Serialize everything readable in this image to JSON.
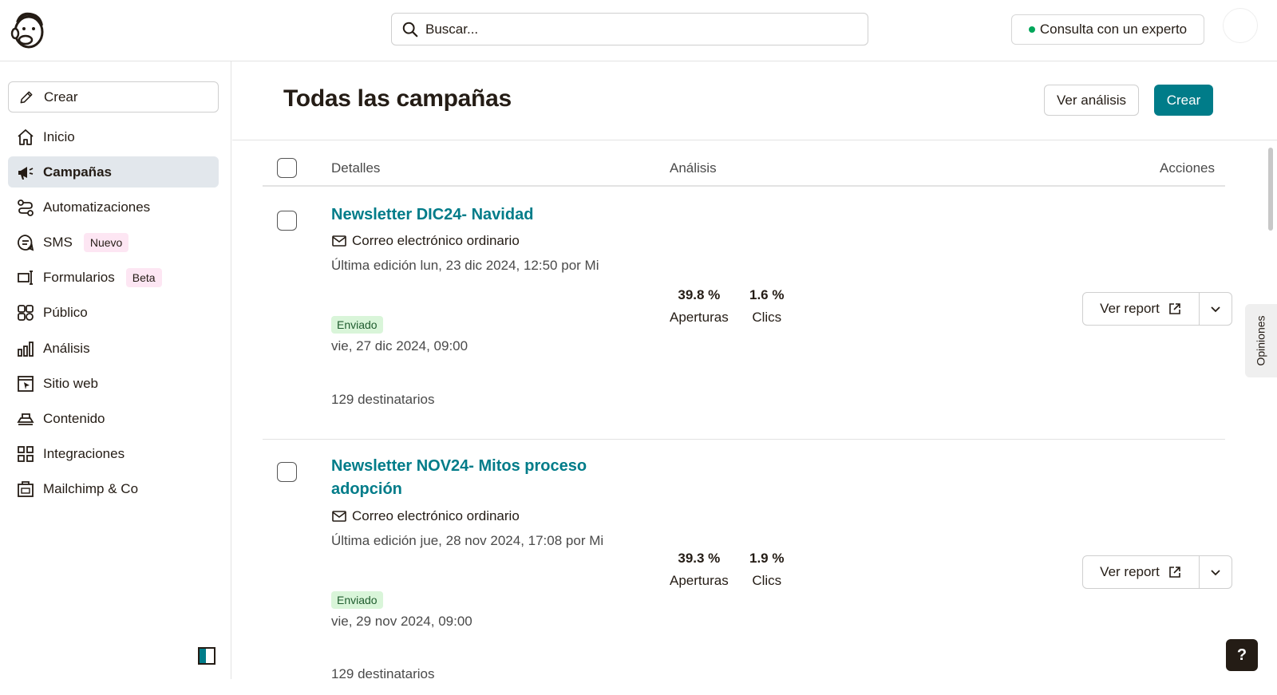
{
  "search": {
    "placeholder": "Buscar..."
  },
  "header": {
    "expert_label": "Consulta con un experto",
    "status_color": "#00a65a"
  },
  "sidebar": {
    "create_label": "Crear",
    "items": [
      {
        "label": "Inicio",
        "icon": "home-icon"
      },
      {
        "label": "Campañas",
        "icon": "megaphone-icon",
        "active": true
      },
      {
        "label": "Automatizaciones",
        "icon": "automation-icon"
      },
      {
        "label": "SMS",
        "icon": "sms-icon",
        "badge": "Nuevo"
      },
      {
        "label": "Formularios",
        "icon": "forms-icon",
        "badge": "Beta"
      },
      {
        "label": "Público",
        "icon": "audience-icon"
      },
      {
        "label": "Análisis",
        "icon": "analytics-icon"
      },
      {
        "label": "Sitio web",
        "icon": "website-icon"
      },
      {
        "label": "Contenido",
        "icon": "content-icon"
      },
      {
        "label": "Integraciones",
        "icon": "integrations-icon"
      },
      {
        "label": "Mailchimp & Co",
        "icon": "mailchimp-co-icon"
      }
    ]
  },
  "page": {
    "title": "Todas las campañas",
    "analysis_button": "Ver análisis",
    "create_button": "Crear",
    "accent_color": "#007c89"
  },
  "table": {
    "headers": {
      "details": "Detalles",
      "analysis": "Análisis",
      "actions": "Acciones"
    },
    "rows": [
      {
        "title": "Newsletter DIC24- Navidad",
        "type": "Correo electrónico ordinario",
        "edited": "Última edición lun, 23 dic 2024, 12:50 por Mi",
        "status": "Enviado",
        "sent_date": "vie, 27 dic 2024, 09:00",
        "recipients": "129 destinatarios",
        "opens_value": "39.8 %",
        "opens_label": "Aperturas",
        "clicks_value": "1.6 %",
        "clicks_label": "Clics",
        "report_label": "Ver report"
      },
      {
        "title_line1": "Newsletter NOV24- Mitos proceso",
        "title_line2": "adopción",
        "type": "Correo electrónico ordinario",
        "edited": "Última edición jue, 28 nov 2024, 17:08 por Mi",
        "status": "Enviado",
        "sent_date": "vie, 29 nov 2024, 09:00",
        "recipients": "129 destinatarios",
        "opens_value": "39.3 %",
        "opens_label": "Aperturas",
        "clicks_value": "1.9 %",
        "clicks_label": "Clics",
        "report_label": "Ver report"
      }
    ]
  },
  "feedback_tab": "Opiniones",
  "help_label": "?"
}
